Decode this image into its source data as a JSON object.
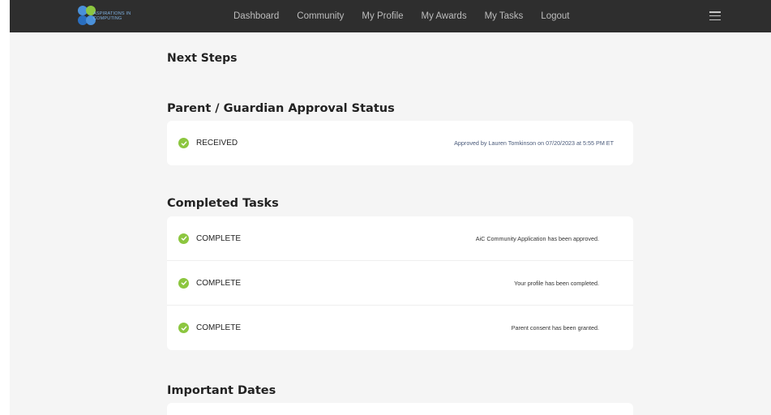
{
  "header": {
    "logo_text_line1": "ASPIRATIONS IN",
    "logo_text_line2": "COMPUTING",
    "nav": [
      "Dashboard",
      "Community",
      "My Profile",
      "My Awards",
      "My Tasks",
      "Logout"
    ],
    "menu_icon": "hamburger-icon"
  },
  "main": {
    "next_steps_title": "Next Steps",
    "approval": {
      "title": "Parent / Guardian Approval Status",
      "status": "RECEIVED",
      "detail": "Approved by Lauren Tomkinson on 07/20/2023 at 5:55 PM ET"
    },
    "completed": {
      "title": "Completed Tasks",
      "tasks": [
        {
          "status": "COMPLETE",
          "detail": "AiC Community Application has been approved."
        },
        {
          "status": "COMPLETE",
          "detail": "Your profile has been completed."
        },
        {
          "status": "COMPLETE",
          "detail": "Parent consent has been granted."
        }
      ]
    },
    "important_dates_title": "Important Dates"
  },
  "colors": {
    "nav_bg": "#2e2e2e",
    "page_bg": "#f5f5f5",
    "check_green": "#8cc63f",
    "logo_blue": "#4a90d9",
    "logo_green": "#8cc63f"
  }
}
